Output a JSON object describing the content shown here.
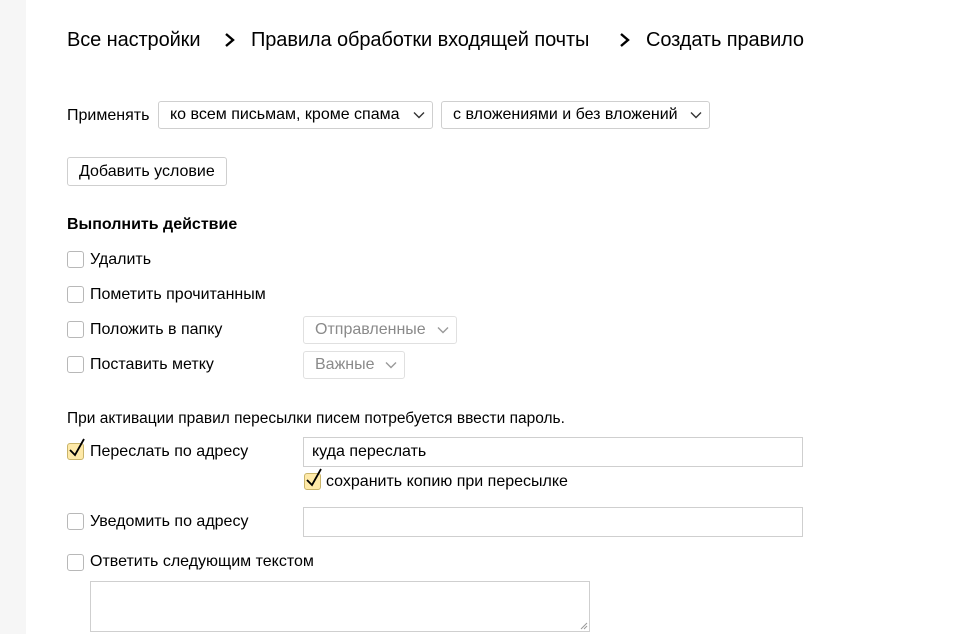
{
  "breadcrumb": {
    "items": [
      "Все настройки",
      "Правила обработки входящей почты",
      "Создать правило"
    ]
  },
  "apply": {
    "label": "Применять",
    "scope_select": "ко всем письмам, кроме спама",
    "attachments_select": "с вложениями и без вложений"
  },
  "add_condition_label": "Добавить условие",
  "actions": {
    "heading": "Выполнить действие",
    "delete_label": "Удалить",
    "mark_read_label": "Пометить прочитанным",
    "move_to_folder_label": "Положить в папку",
    "folder_select": "Отправленные",
    "set_label_label": "Поставить метку",
    "label_select": "Важные"
  },
  "forward": {
    "notice": "При активации правил пересылки писем потребуется ввести пароль.",
    "forward_label": "Переслать по адресу",
    "forward_checked": true,
    "forward_input_value": "куда переслать",
    "keep_copy_label": "сохранить копию при пересылке",
    "keep_copy_checked": true,
    "notify_label": "Уведомить по адресу",
    "notify_checked": false,
    "notify_input_value": "",
    "reply_label": "Ответить следующим текстом",
    "reply_checked": false,
    "reply_text": ""
  },
  "colors": {
    "checked_fill": "#fee9a8",
    "page_background": "#ffffff",
    "side_background": "#f6f6f6"
  }
}
